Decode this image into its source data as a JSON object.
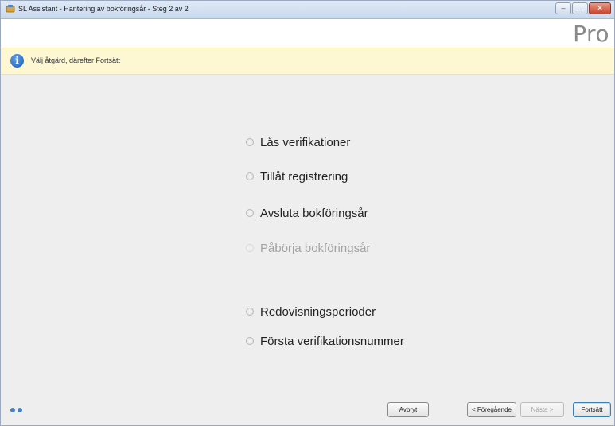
{
  "window": {
    "title": "SL Assistant - Hantering av bokföringsår - Steg 2 av 2",
    "controls": {
      "minimize": "–",
      "maximize": "□",
      "close": "✕"
    },
    "brand": "Pro"
  },
  "info_bar": {
    "icon": "info-icon",
    "text": "Välj åtgärd, därefter Fortsätt"
  },
  "options": [
    {
      "label": "Lås verifikationer",
      "enabled": true
    },
    {
      "label": "Tillåt registrering",
      "enabled": true
    },
    {
      "label": "Avsluta bokföringsår",
      "enabled": true
    },
    {
      "label": "Påbörja bokföringsår",
      "enabled": false
    },
    {
      "label": "Redovisningsperioder",
      "enabled": true
    },
    {
      "label": "Första verifikationsnummer",
      "enabled": true
    }
  ],
  "footer": {
    "cancel_label": "Avbryt",
    "previous_label": "< Föregående",
    "next_label": "Nästa >",
    "continue_label": "Fortsätt"
  }
}
